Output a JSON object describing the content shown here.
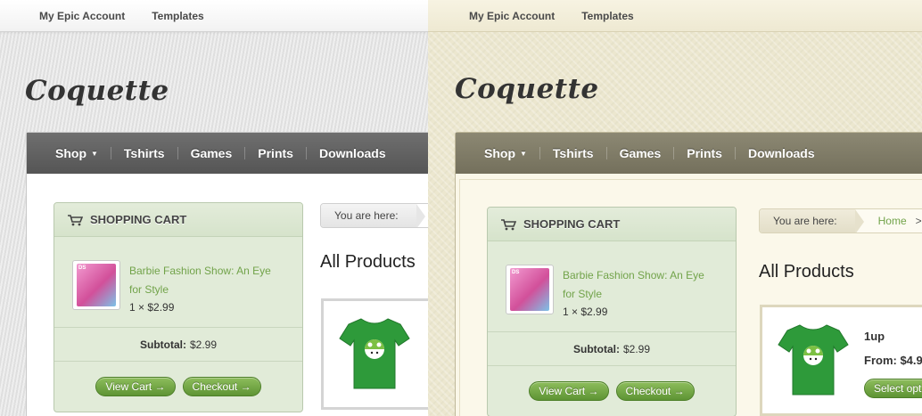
{
  "topnav": {
    "account": "My Epic Account",
    "templates": "Templates"
  },
  "logo": "Coquette",
  "nav": {
    "shop": "Shop",
    "tshirts": "Tshirts",
    "games": "Games",
    "prints": "Prints",
    "downloads": "Downloads"
  },
  "cart": {
    "title": "SHOPPING CART",
    "item_name": "Barbie Fashion Show: An Eye for Style",
    "item_qty": "1 × $2.99",
    "subtotal_label": "Subtotal:",
    "subtotal_value": "$2.99",
    "view_cart": "View Cart →",
    "checkout": "Checkout →"
  },
  "breadcrumb": {
    "here": "You are here:",
    "home": "Home",
    "sep": ">"
  },
  "heading": "All Products",
  "product": {
    "name": "1up",
    "price": "From: $4.9",
    "button": "Select opti"
  },
  "colors": {
    "link_green": "#72a34a",
    "button_green": "#6ea343",
    "nav_gray": "#5f5f5f",
    "nav_olive": "#7f7b66"
  }
}
